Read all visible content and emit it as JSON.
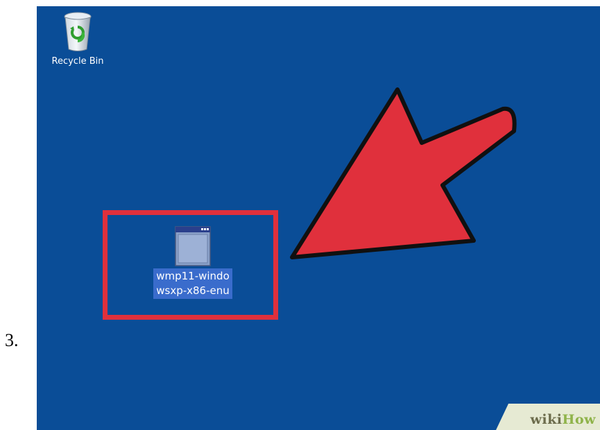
{
  "step": {
    "number": "3."
  },
  "desktop": {
    "background_color": "#0a4d97",
    "icons": [
      {
        "label": "Recycle Bin",
        "icon": "recycle-bin-icon",
        "selected": false
      },
      {
        "label_lines": [
          "wmp11-windo",
          "wsxp-x86-enu"
        ],
        "icon": "application-window-icon",
        "selected": true
      }
    ]
  },
  "annotations": {
    "highlight_color": "#e0303c",
    "arrow_color": "#e0303c",
    "arrow_icon": "pointer-arrow-icon"
  },
  "watermark": {
    "part1": "wiki",
    "part2": "How"
  }
}
